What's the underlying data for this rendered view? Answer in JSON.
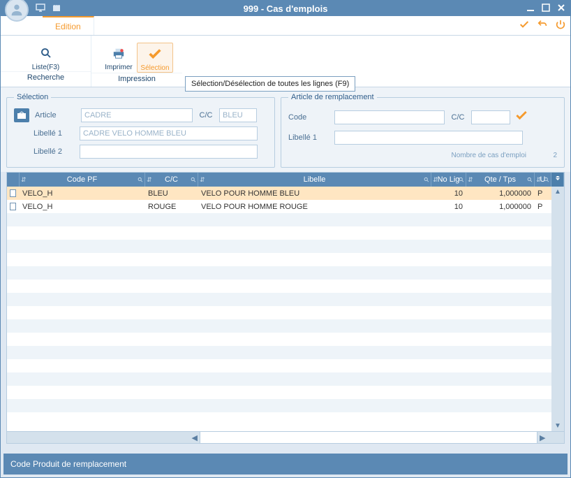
{
  "title": "999 - Cas d'emplois",
  "tabs": {
    "edition": "Edition"
  },
  "tab_actions": {
    "confirm": "✓",
    "back": "↶",
    "power": "⏻"
  },
  "toolbar": {
    "group1": {
      "label": "Recherche",
      "btn_liste": "Liste(F3)"
    },
    "group2": {
      "label": "Impression",
      "btn_imprimer": "Imprimer",
      "btn_selection": "Sélection"
    }
  },
  "tooltip": "Sélection/Désélection de toutes les lignes (F9)",
  "panel_selection": {
    "legend": "Sélection",
    "article_label": "Article",
    "article_value": "CADRE",
    "cc_label": "C/C",
    "cc_value": "BLEU",
    "libelle1_label": "Libellé 1",
    "libelle1_value": "CADRE VELO HOMME BLEU",
    "libelle2_label": "Libellé 2",
    "libelle2_value": ""
  },
  "panel_remplacement": {
    "legend": "Article de remplacement",
    "code_label": "Code",
    "code_value": "",
    "cc_label": "C/C",
    "cc_value": "",
    "libelle1_label": "Libellé 1",
    "libelle1_value": "",
    "count_label": "Nombre de cas d'emploi",
    "count_value": "2"
  },
  "table": {
    "headers": {
      "code": "Code PF",
      "cc": "C/C",
      "libelle": "Libelle",
      "nolig": "No Lig",
      "qte": "Qte / Tps",
      "u": "U"
    },
    "rows": [
      {
        "code": "VELO_H",
        "cc": "BLEU",
        "libelle": "VELO POUR HOMME BLEU",
        "nolig": "10",
        "qte": "1,000000",
        "u": "P"
      },
      {
        "code": "VELO_H",
        "cc": "ROUGE",
        "libelle": "VELO POUR HOMME ROUGE",
        "nolig": "10",
        "qte": "1,000000",
        "u": "P"
      }
    ]
  },
  "statusbar": "Code Produit de remplacement"
}
